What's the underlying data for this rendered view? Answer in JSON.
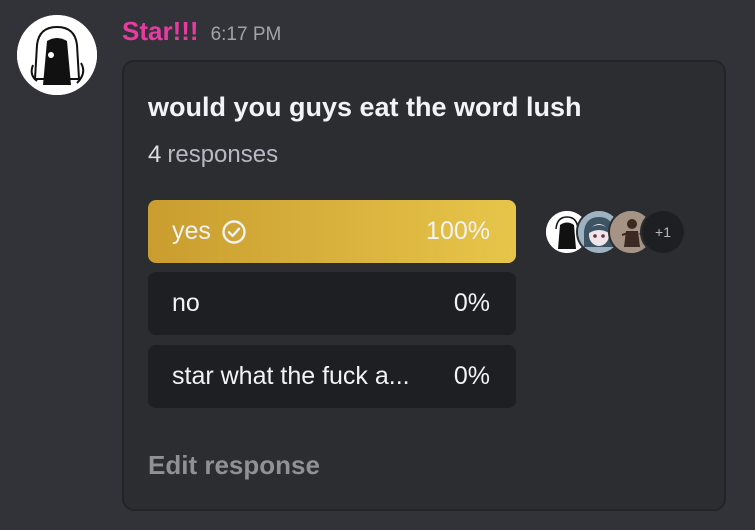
{
  "message": {
    "username": "Star!!!",
    "timestamp": "6:17 PM",
    "colors": {
      "username": "#e63ba1",
      "winner_bar_start": "#c99d2f",
      "winner_bar_end": "#e7c54a"
    }
  },
  "poll": {
    "question": "would you guys eat the word lush",
    "response_count": "4",
    "response_label": "responses",
    "answers": [
      {
        "label": "yes",
        "percent": "100%",
        "voted": true,
        "icon": "check-circle-icon"
      },
      {
        "label": "no",
        "percent": "0%"
      },
      {
        "label": "star what the fuck a...",
        "percent": "0%"
      }
    ],
    "voters_more": "+1",
    "edit_label": "Edit response"
  }
}
